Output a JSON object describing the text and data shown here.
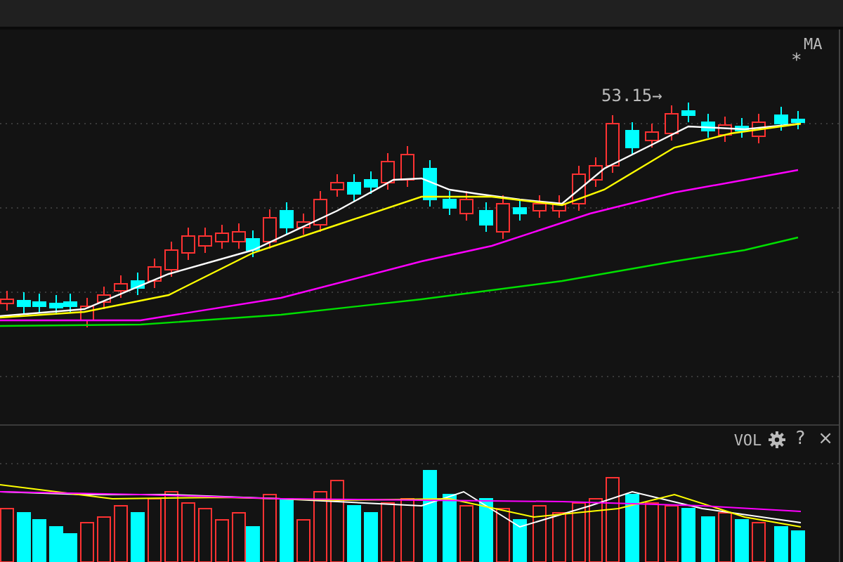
{
  "price_panel": {
    "indicator_label": "MA",
    "indicator_marker": "*",
    "high_annotation": "53.15→"
  },
  "volume_panel": {
    "label": "VOL",
    "help": "?",
    "close": "×"
  }
}
